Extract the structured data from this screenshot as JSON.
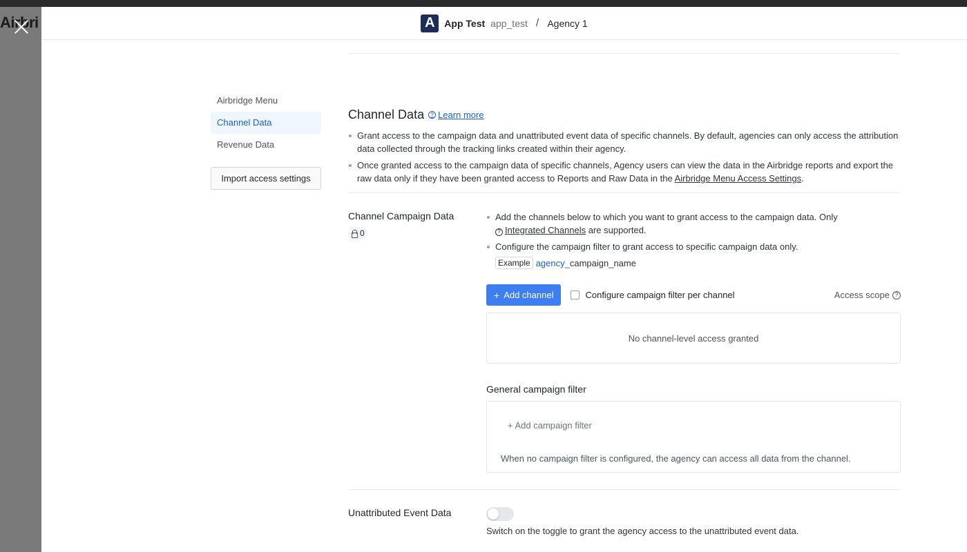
{
  "backdrop": {
    "logo_text": "Airbri"
  },
  "header": {
    "logo_letter": "A",
    "app_name": "App Test",
    "app_id": "app_test",
    "separator": "/",
    "agency_name": "Agency 1"
  },
  "sidebar": {
    "items": [
      {
        "label": "Airbridge Menu",
        "active": false
      },
      {
        "label": "Channel Data",
        "active": true
      },
      {
        "label": "Revenue Data",
        "active": false
      }
    ],
    "import_button": "Import access settings"
  },
  "channel_data": {
    "title": "Channel Data",
    "learn_more": "Learn more",
    "bullet_1": "Grant access to the campaign data and unattributed event data of specific channels. By default, agencies can only access the attribution data collected through the tracking links created within their agency.",
    "bullet_2_prefix": "Once granted access to the campaign data of specific channels, Agency users can view the data in the Airbridge reports and export the raw data only if they have been granted access to Reports and Raw Data in the ",
    "bullet_2_link": "Airbridge Menu Access Settings",
    "bullet_2_suffix": "."
  },
  "campaign_data": {
    "label": "Channel Campaign Data",
    "badge_count": "0",
    "bullet_1_prefix": "Add the channels below to which you want to grant access to the campaign data. Only",
    "bullet_1_link": "Integrated Channels",
    "bullet_1_suffix": " are supported.",
    "bullet_2": "Configure the campaign filter to grant access to specific campaign data only.",
    "example_tag": "Example",
    "example_blue": "agency_",
    "example_rest": "campaign_name",
    "add_channel_button": "Add channel",
    "checkbox_label": "Configure campaign filter per channel",
    "access_scope": "Access scope",
    "empty_message": "No channel-level access granted",
    "general_filter_title": "General campaign filter",
    "add_filter": "+ Add campaign filter",
    "filter_note": "When no campaign filter is configured, the agency can access all data from the channel."
  },
  "unattributed": {
    "label": "Unattributed Event Data",
    "toggle_on": false,
    "note": "Switch on the toggle to grant the agency access to the unattributed event data."
  },
  "colors": {
    "primary": "#3d7ef0",
    "link": "#1a5fd6",
    "active_nav_bg": "#eff6ff",
    "logo_bg": "#1c2c5b"
  }
}
